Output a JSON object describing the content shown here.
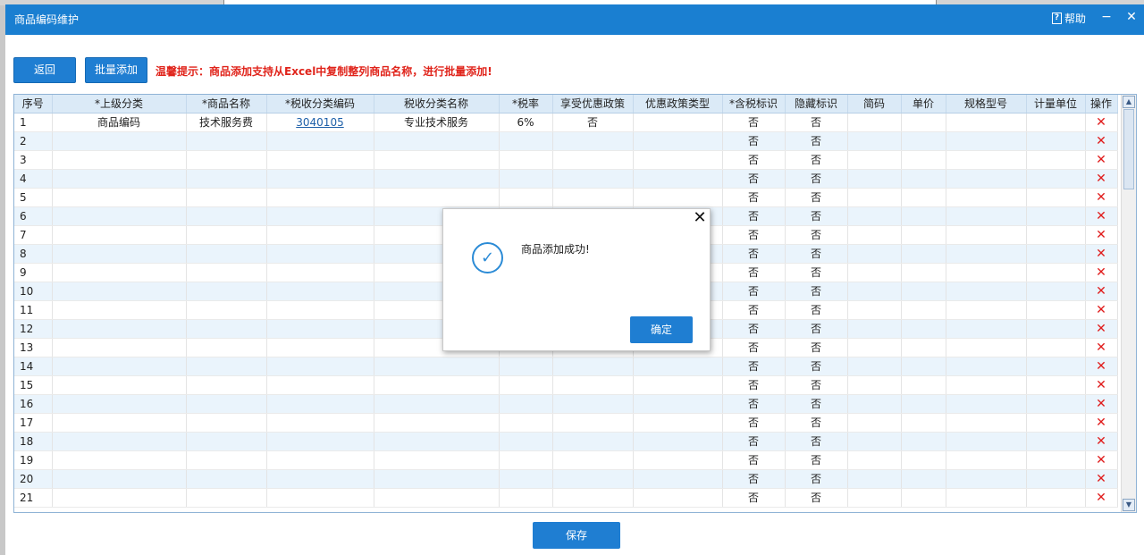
{
  "window": {
    "title": "商品编码维护",
    "help_label": "帮助",
    "minimize_label": "−",
    "close_label": "✕"
  },
  "toolbar": {
    "back_label": "返回",
    "batch_add_label": "批量添加",
    "tip": "温馨提示：商品添加支持从Excel中复制整列商品名称，进行批量添加!"
  },
  "table": {
    "columns": [
      "序号",
      "*上级分类",
      "*商品名称",
      "*税收分类编码",
      "税收分类名称",
      "*税率",
      "享受优惠政策",
      "优惠政策类型",
      "*含税标识",
      "隐藏标识",
      "简码",
      "单价",
      "规格型号",
      "计量单位",
      "操作"
    ],
    "rows": [
      {
        "no": "1",
        "parent": "商品编码",
        "name": "技术服务费",
        "tax_code": "3040105",
        "tax_name": "专业技术服务",
        "rate": "6%",
        "preferential": "否",
        "pref_type": "",
        "tax_incl": "否",
        "hidden": "否",
        "short_code": "",
        "price": "",
        "spec": "",
        "unit": ""
      },
      {
        "no": "2",
        "tax_incl": "否",
        "hidden": "否"
      },
      {
        "no": "3",
        "tax_incl": "否",
        "hidden": "否"
      },
      {
        "no": "4",
        "tax_incl": "否",
        "hidden": "否"
      },
      {
        "no": "5",
        "tax_incl": "否",
        "hidden": "否"
      },
      {
        "no": "6",
        "tax_incl": "否",
        "hidden": "否"
      },
      {
        "no": "7",
        "tax_incl": "否",
        "hidden": "否"
      },
      {
        "no": "8",
        "tax_incl": "否",
        "hidden": "否"
      },
      {
        "no": "9",
        "tax_incl": "否",
        "hidden": "否"
      },
      {
        "no": "10",
        "tax_incl": "否",
        "hidden": "否"
      },
      {
        "no": "11",
        "tax_incl": "否",
        "hidden": "否"
      },
      {
        "no": "12",
        "tax_incl": "否",
        "hidden": "否"
      },
      {
        "no": "13",
        "tax_incl": "否",
        "hidden": "否"
      },
      {
        "no": "14",
        "tax_incl": "否",
        "hidden": "否"
      },
      {
        "no": "15",
        "tax_incl": "否",
        "hidden": "否"
      },
      {
        "no": "16",
        "tax_incl": "否",
        "hidden": "否"
      },
      {
        "no": "17",
        "tax_incl": "否",
        "hidden": "否"
      },
      {
        "no": "18",
        "tax_incl": "否",
        "hidden": "否"
      },
      {
        "no": "19",
        "tax_incl": "否",
        "hidden": "否"
      },
      {
        "no": "20",
        "tax_incl": "否",
        "hidden": "否"
      },
      {
        "no": "21",
        "tax_incl": "否",
        "hidden": "否"
      }
    ],
    "delete_icon": "close-icon"
  },
  "footer": {
    "save_label": "保存"
  },
  "dialog": {
    "message": "商品添加成功!",
    "ok_label": "确定",
    "icon": "check-circle-icon"
  },
  "colors": {
    "titlebar": "#1a7fd1",
    "primary_button": "#1f7ed2",
    "tip_text": "#e0241b",
    "header_bg": "#dbeaf7",
    "alt_row": "#eaf4fc",
    "delete": "#e01b1b"
  }
}
